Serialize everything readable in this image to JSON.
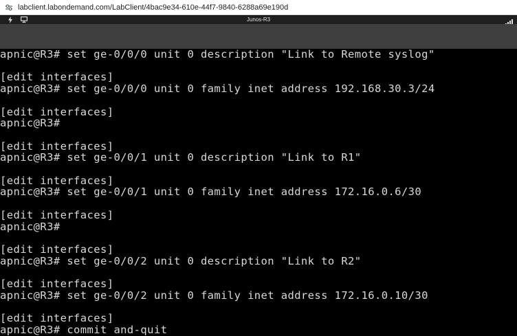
{
  "browser": {
    "url": "labclient.labondemand.com/LabClient/4bac9e34-610e-44f7-9840-6288a69e190d",
    "site_icon": "tune-icon"
  },
  "toolbar": {
    "title": "Junos-R3",
    "icons": [
      "power-icon",
      "monitor-icon",
      "signal-icon"
    ]
  },
  "terminal": {
    "lines": [
      "apnic@R3# set ge-0/0/0 unit 0 description \"Link to Remote syslog\"",
      "",
      "[edit interfaces]",
      "apnic@R3# set ge-0/0/0 unit 0 family inet address 192.168.30.3/24",
      "",
      "[edit interfaces]",
      "apnic@R3#",
      "",
      "[edit interfaces]",
      "apnic@R3# set ge-0/0/1 unit 0 description \"Link to R1\"",
      "",
      "[edit interfaces]",
      "apnic@R3# set ge-0/0/1 unit 0 family inet address 172.16.0.6/30",
      "",
      "[edit interfaces]",
      "apnic@R3#",
      "",
      "[edit interfaces]",
      "apnic@R3# set ge-0/0/2 unit 0 description \"Link to R2\"",
      "",
      "[edit interfaces]",
      "apnic@R3# set ge-0/0/2 unit 0 family inet address 172.16.0.10/30",
      "",
      "[edit interfaces]",
      "apnic@R3# commit and-quit"
    ]
  }
}
